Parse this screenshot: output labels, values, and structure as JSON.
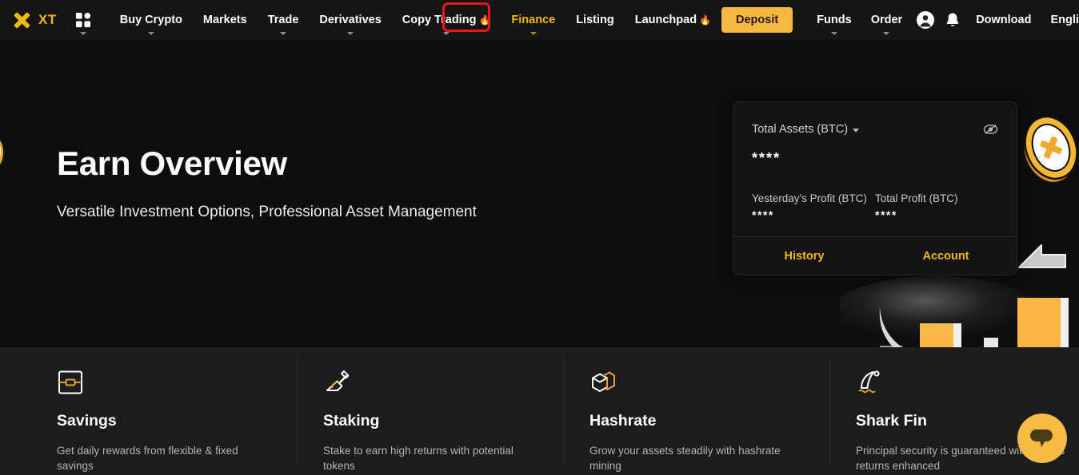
{
  "brand": {
    "name": "XT",
    "logo_icon": "xt-logo-icon",
    "accent": "#f0b90b",
    "deposit_bg": "#f5b941",
    "annotation_color": "#e8171b"
  },
  "navbar": {
    "apps_icon": "apps-grid-icon",
    "items": [
      {
        "label": "Buy Crypto",
        "has_caret": true,
        "flame": false,
        "active": false
      },
      {
        "label": "Markets",
        "has_caret": false,
        "flame": false,
        "active": false
      },
      {
        "label": "Trade",
        "has_caret": true,
        "flame": false,
        "active": false
      },
      {
        "label": "Derivatives",
        "has_caret": true,
        "flame": false,
        "active": false
      },
      {
        "label": "Copy Trading",
        "has_caret": true,
        "flame": true,
        "active": false
      },
      {
        "label": "Finance",
        "has_caret": true,
        "flame": false,
        "active": true
      },
      {
        "label": "Listing",
        "has_caret": false,
        "flame": false,
        "active": false
      },
      {
        "label": "Launchpad",
        "has_caret": false,
        "flame": true,
        "active": false
      }
    ],
    "deposit_label": "Deposit",
    "right_items": [
      {
        "label": "Funds",
        "has_caret": true
      },
      {
        "label": "Order",
        "has_caret": true
      }
    ],
    "profile_icon": "user-avatar-icon",
    "bell_icon": "notification-bell-icon",
    "download_label": "Download",
    "locale_label": "English/USD",
    "locale_has_caret": true
  },
  "hero": {
    "title": "Earn Overview",
    "subtitle": "Versatile Investment Options, Professional Asset Management",
    "decorations": [
      "xt-coin-icon",
      "dollar-coin-icon",
      "bar-chart-graphic",
      "arrow-graphic"
    ]
  },
  "asset_card": {
    "total_assets_label": "Total Assets (BTC)",
    "total_assets_value": "****",
    "visibility_icon": "eye-off-icon",
    "dropdown_icon": "chevron-down-icon",
    "yesterday_profit_label": "Yesterday's Profit (BTC)",
    "yesterday_profit_value": "****",
    "total_profit_label": "Total Profit (BTC)",
    "total_profit_value": "****",
    "history_label": "History",
    "account_label": "Account"
  },
  "features": [
    {
      "icon": "savings-wallet-icon",
      "title": "Savings",
      "desc": "Get daily rewards from flexible & fixed savings"
    },
    {
      "icon": "staking-shovel-icon",
      "title": "Staking",
      "desc": "Stake to earn high returns with potential tokens"
    },
    {
      "icon": "hashrate-cube-icon",
      "title": "Hashrate",
      "desc": "Grow your assets steadily with hashrate mining"
    },
    {
      "icon": "shark-fin-icon",
      "title": "Shark Fin",
      "desc": "Principal security is guaranteed with excess returns enhanced"
    }
  ],
  "chat_widget": {
    "icon": "chat-bubble-icon"
  }
}
